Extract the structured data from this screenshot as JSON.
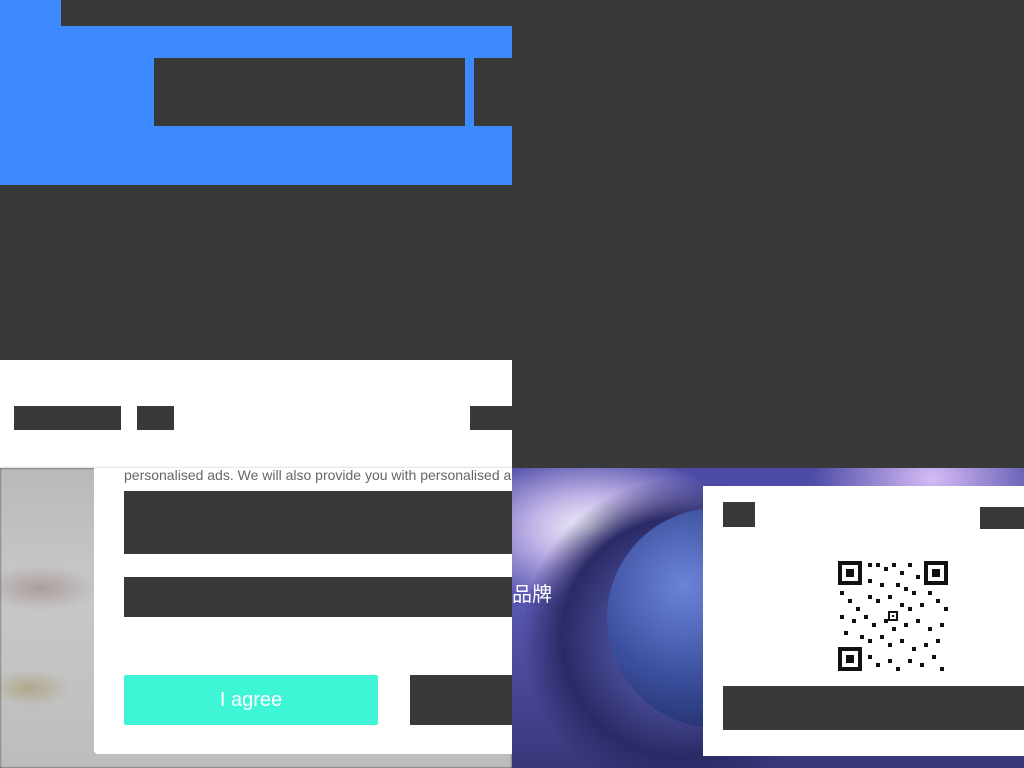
{
  "consent": {
    "text": "personalised ads. We will also provide you with personalised a",
    "agree_label": "I agree"
  },
  "promo": {
    "brand_text": "品牌"
  },
  "icons": {
    "qr": "qr-code"
  },
  "colors": {
    "blue": "#3d8bff",
    "agree": "#3ef5d6",
    "redaction": "#393939"
  }
}
